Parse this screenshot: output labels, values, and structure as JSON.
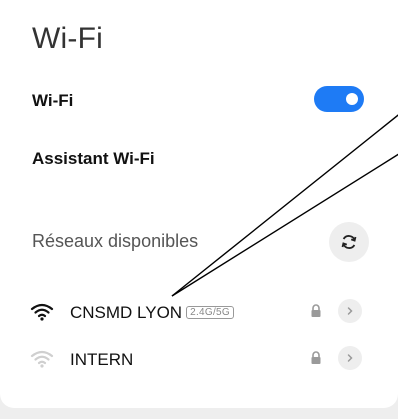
{
  "page": {
    "title": "Wi-Fi"
  },
  "settings": {
    "wifi_label": "Wi-Fi",
    "wifi_enabled": true,
    "assistant_label": "Assistant Wi-Fi"
  },
  "networks_section": {
    "label": "Réseaux disponibles",
    "refresh_icon": "refresh-icon",
    "networks": [
      {
        "name": "CNSMD LYON",
        "band_badge": "2.4G/5G",
        "signal": "full",
        "secured": true
      },
      {
        "name": "INTERN",
        "band_badge": "",
        "signal": "weak",
        "secured": true
      }
    ]
  },
  "colors": {
    "accent": "#1e7bf5",
    "annotation_lines": "#000000"
  }
}
